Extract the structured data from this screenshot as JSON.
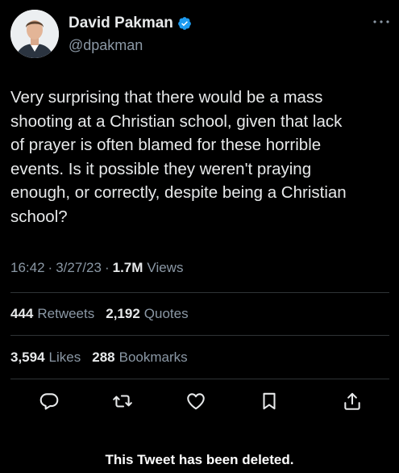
{
  "author": {
    "display_name": "David Pakman",
    "handle": "@dpakman",
    "verified": true,
    "verified_color": "#1d9bf0"
  },
  "tweet": {
    "text": "Very surprising that there would be a mass\nshooting at a Christian school, given that lack\nof prayer is often blamed for these horrible\nevents. Is it possible they weren't praying\nenough, or correctly, despite being a Christian\nschool?",
    "time": "16:42",
    "date": "3/27/23",
    "separator": "·",
    "views_count": "1.7M",
    "views_label": "Views"
  },
  "stats": {
    "retweets_count": "444",
    "retweets_label": "Retweets",
    "quotes_count": "2,192",
    "quotes_label": "Quotes",
    "likes_count": "3,594",
    "likes_label": "Likes",
    "bookmarks_count": "288",
    "bookmarks_label": "Bookmarks"
  },
  "actions": {
    "icons": [
      "reply-icon",
      "retweet-icon",
      "like-icon",
      "bookmark-icon",
      "share-icon"
    ],
    "more_icon": "more-options-icon"
  },
  "footer": {
    "notice": "This Tweet has been deleted."
  },
  "colors": {
    "background": "#000000",
    "text_primary": "#e7e9ea",
    "text_secondary": "#8b98a5",
    "divider": "#2f3336"
  }
}
